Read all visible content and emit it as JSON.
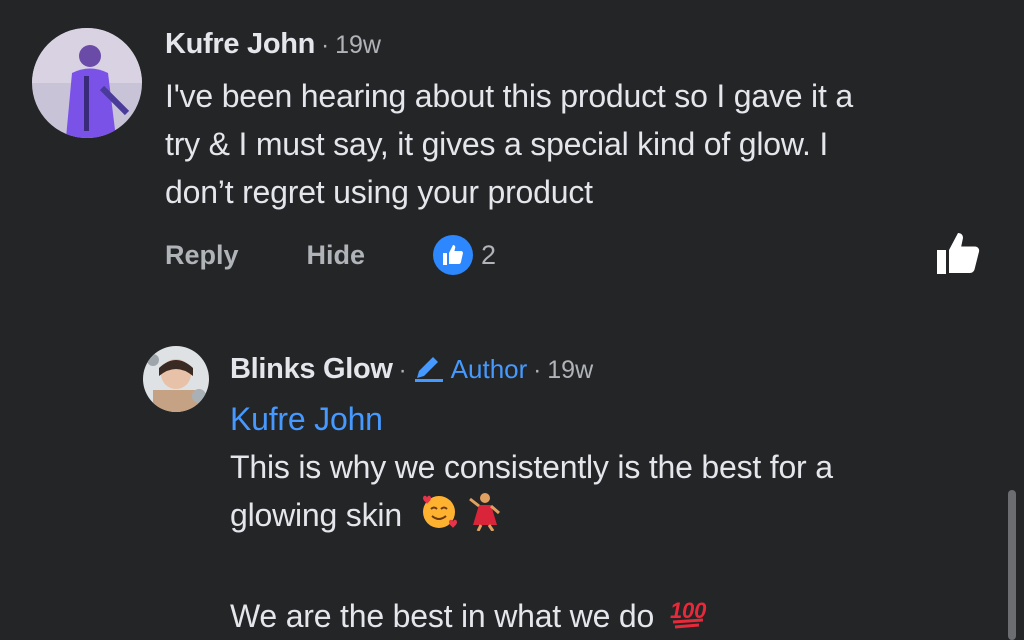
{
  "comment": {
    "author": "Kufre John",
    "time": "19w",
    "text_line1": "I've been hearing about this product so I gave it a",
    "text_line2": "try & I must say, it gives a special kind of glow. I",
    "text_line3": "don’t regret using your product",
    "actions": {
      "reply": "Reply",
      "hide": "Hide",
      "like_count": "2"
    }
  },
  "reply": {
    "author": "Blinks Glow",
    "badge": "Author",
    "time": "19w",
    "mention": "Kufre John",
    "text_line1": "This is why we consistently is the best for a",
    "text_line2": "glowing skin",
    "text_line3": "We are the best in what we do"
  },
  "icons": {
    "like_badge": "thumbs-up-icon",
    "like_button": "thumbs-up-outline-icon",
    "author_badge": "pencil-icon",
    "emoji_1": "smiling-face-with-hearts-emoji",
    "emoji_2": "woman-dancing-emoji",
    "emoji_3": "hundred-points-emoji"
  },
  "colors": {
    "background": "#242526",
    "text": "#e4e6eb",
    "secondary": "#b0b3b8",
    "accent": "#2d88ff",
    "link": "#4599ff"
  }
}
